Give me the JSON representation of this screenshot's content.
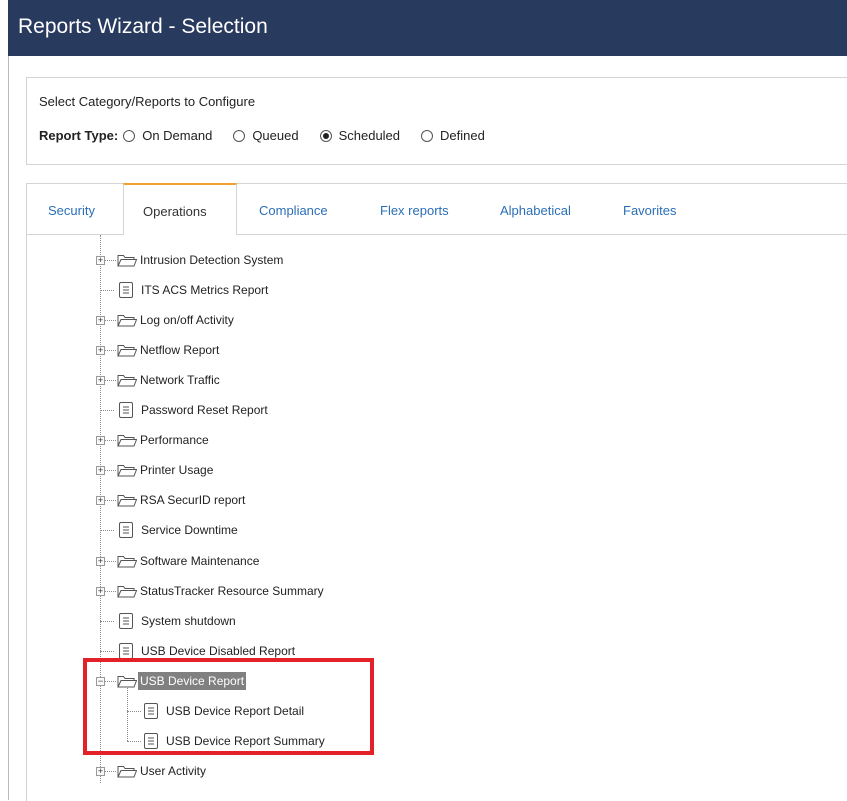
{
  "window": {
    "title": "Reports Wizard - Selection"
  },
  "config": {
    "prompt": "Select Category/Reports to Configure",
    "report_type_label": "Report Type:",
    "options": [
      {
        "label": "On Demand",
        "selected": false
      },
      {
        "label": "Queued",
        "selected": false
      },
      {
        "label": "Scheduled",
        "selected": true
      },
      {
        "label": "Defined",
        "selected": false
      }
    ]
  },
  "tabs": [
    {
      "label": "Security",
      "active": false
    },
    {
      "label": "Operations",
      "active": true
    },
    {
      "label": "Compliance",
      "active": false
    },
    {
      "label": "Flex reports",
      "active": false
    },
    {
      "label": "Alphabetical",
      "active": false
    },
    {
      "label": "Favorites",
      "active": false
    }
  ],
  "tree": {
    "items": [
      {
        "label": "Intrusion Detection System",
        "type": "folder",
        "level": 0,
        "expandable": true
      },
      {
        "label": "ITS ACS Metrics Report",
        "type": "report",
        "level": 0
      },
      {
        "label": "Log on/off Activity",
        "type": "folder",
        "level": 0,
        "expandable": true
      },
      {
        "label": "Netflow Report",
        "type": "folder",
        "level": 0,
        "expandable": true
      },
      {
        "label": "Network Traffic",
        "type": "folder",
        "level": 0,
        "expandable": true
      },
      {
        "label": "Password Reset Report",
        "type": "report",
        "level": 0
      },
      {
        "label": "Performance",
        "type": "folder",
        "level": 0,
        "expandable": true
      },
      {
        "label": "Printer Usage",
        "type": "folder",
        "level": 0,
        "expandable": true
      },
      {
        "label": "RSA SecurID report",
        "type": "folder",
        "level": 0,
        "expandable": true
      },
      {
        "label": "Service Downtime",
        "type": "report",
        "level": 0
      },
      {
        "label": "Software Maintenance",
        "type": "folder",
        "level": 0,
        "expandable": true
      },
      {
        "label": "StatusTracker Resource Summary",
        "type": "folder",
        "level": 0,
        "expandable": true
      },
      {
        "label": "System shutdown",
        "type": "report",
        "level": 0
      },
      {
        "label": "USB Device Disabled Report",
        "type": "report",
        "level": 0
      },
      {
        "label": "USB Device Report",
        "type": "folder",
        "level": 0,
        "expandable": true,
        "expanded": true,
        "selected": true
      },
      {
        "label": "USB Device Report Detail",
        "type": "report",
        "level": 1
      },
      {
        "label": "USB Device Report Summary",
        "type": "report",
        "level": 1
      },
      {
        "label": "User Activity",
        "type": "folder",
        "level": 0,
        "expandable": true
      }
    ]
  },
  "colors": {
    "titlebar": "#283a5e",
    "tab_text": "#2a6fb6",
    "active_tab_accent": "#f0a030",
    "selected_node_bg": "#808080",
    "highlight_box": "#e32128"
  }
}
